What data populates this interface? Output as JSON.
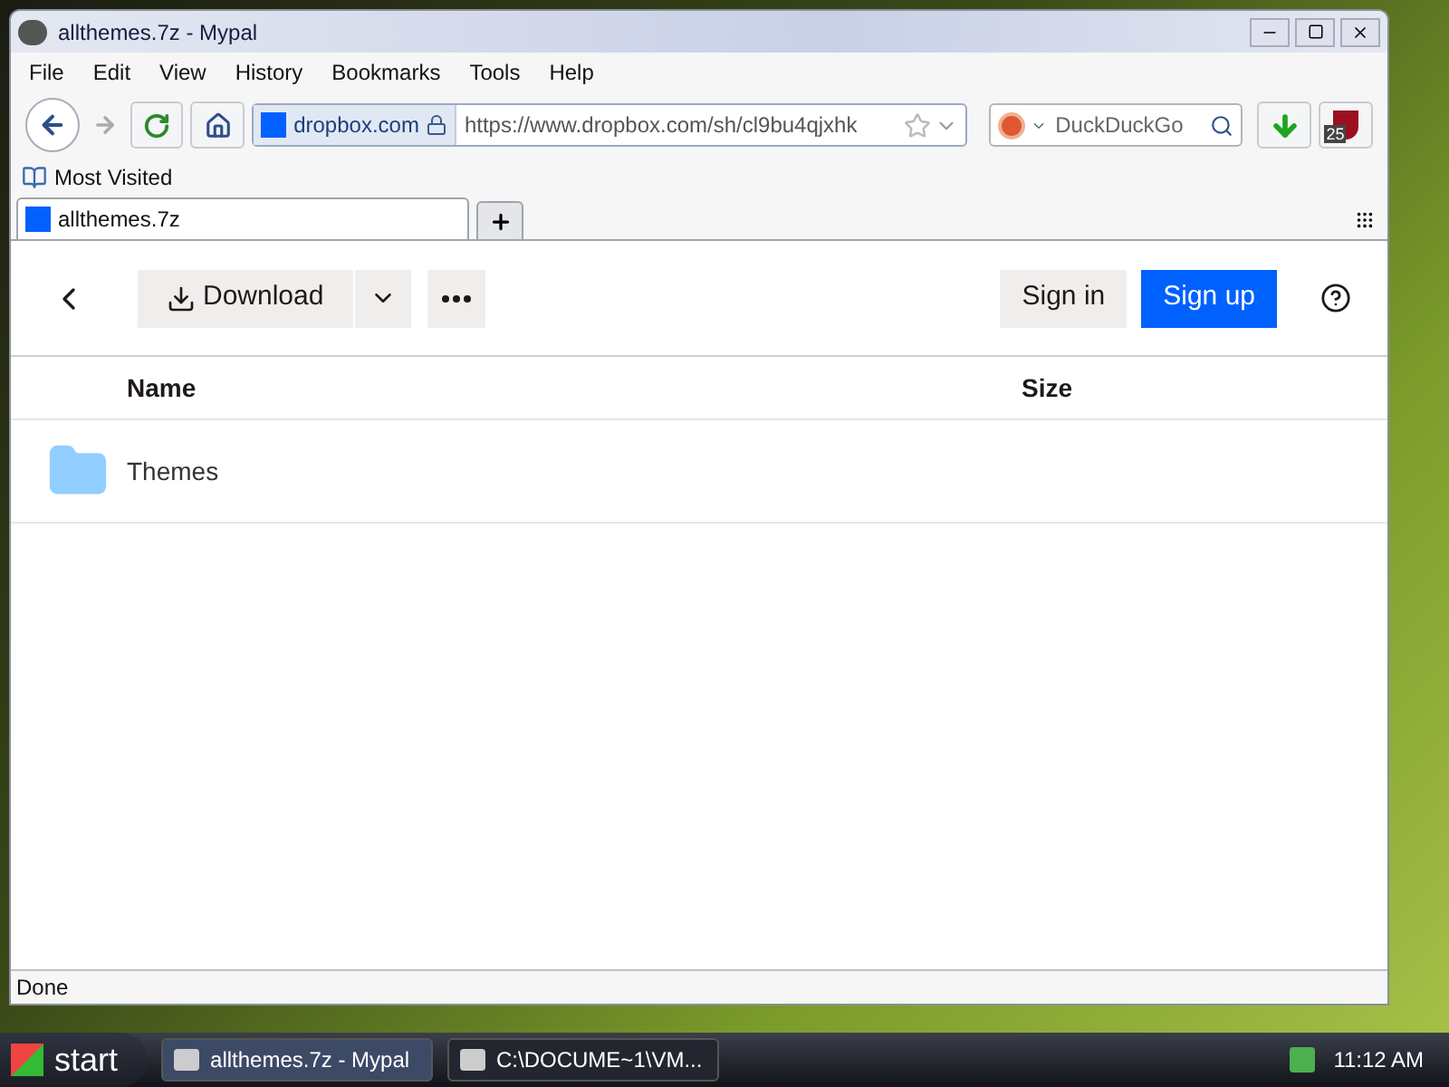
{
  "window": {
    "title": "allthemes.7z - Mypal"
  },
  "menu": [
    "File",
    "Edit",
    "View",
    "History",
    "Bookmarks",
    "Tools",
    "Help"
  ],
  "navigation": {
    "site": "dropbox.com",
    "url": "https://www.dropbox.com/sh/cl9bu4qjxhk",
    "search_placeholder": "DuckDuckGo",
    "addon_badge": "25"
  },
  "bookmarks": [
    "Most Visited"
  ],
  "tabs": [
    {
      "label": "allthemes.7z",
      "selected": true
    }
  ],
  "page": {
    "download": "Download",
    "sign_in": "Sign in",
    "sign_up": "Sign up",
    "columns": [
      "Name",
      "Size"
    ],
    "rows": [
      {
        "kind": "folder",
        "name": "Themes"
      }
    ]
  },
  "status_bar": "Done",
  "taskbar": {
    "start": "start",
    "tasks": [
      {
        "label": "allthemes.7z - Mypal",
        "selected": true
      },
      {
        "label": "C:\\DOCUME~1\\VM...",
        "selected": false
      }
    ],
    "clock": "11:12 AM"
  }
}
